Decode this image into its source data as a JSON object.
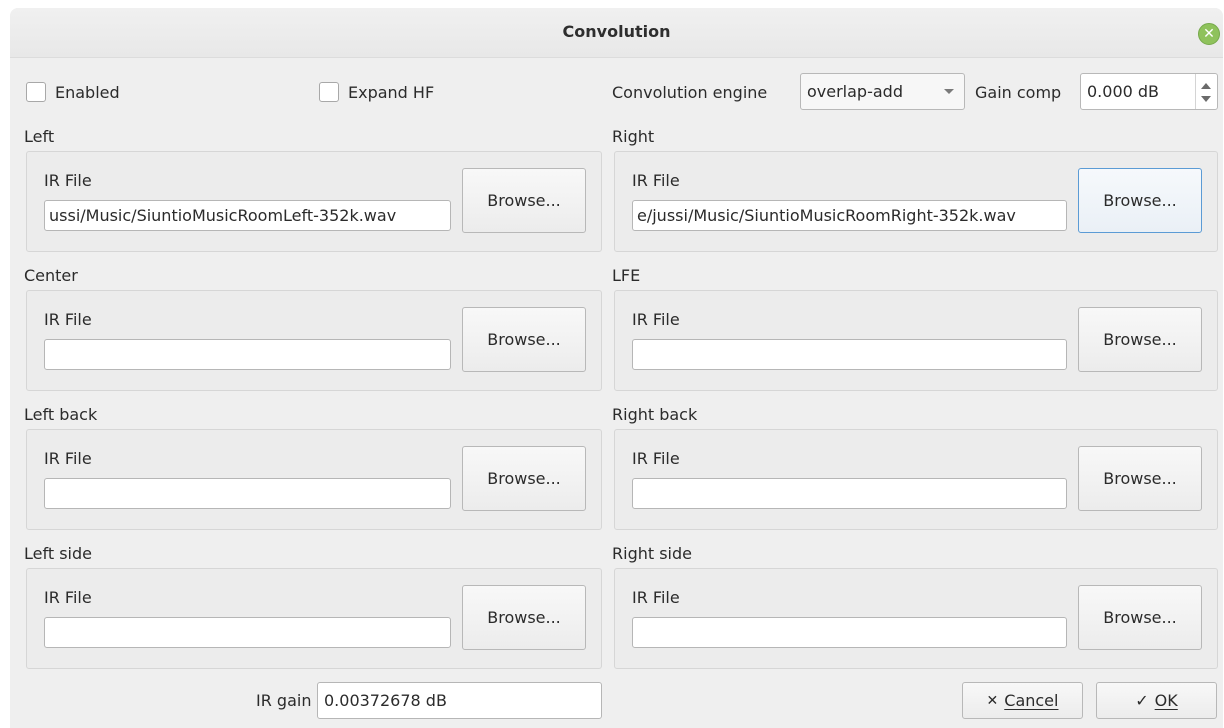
{
  "window": {
    "title": "Convolution"
  },
  "top": {
    "enabled_label": "Enabled",
    "expand_hf_label": "Expand HF",
    "engine_label": "Convolution engine",
    "engine_value": "overlap-add",
    "gain_comp_label": "Gain comp",
    "gain_comp_value": "0.000 dB"
  },
  "channels": [
    {
      "name": "Left",
      "ir_label": "IR File",
      "path": "ussi/Music/SiuntioMusicRoomLeft-352k.wav",
      "browse_label": "Browse..."
    },
    {
      "name": "Right",
      "ir_label": "IR File",
      "path": "e/jussi/Music/SiuntioMusicRoomRight-352k.wav",
      "browse_label": "Browse..."
    },
    {
      "name": "Center",
      "ir_label": "IR File",
      "path": "",
      "browse_label": "Browse..."
    },
    {
      "name": "LFE",
      "ir_label": "IR File",
      "path": "",
      "browse_label": "Browse..."
    },
    {
      "name": "Left back",
      "ir_label": "IR File",
      "path": "",
      "browse_label": "Browse..."
    },
    {
      "name": "Right back",
      "ir_label": "IR File",
      "path": "",
      "browse_label": "Browse..."
    },
    {
      "name": "Left side",
      "ir_label": "IR File",
      "path": "",
      "browse_label": "Browse..."
    },
    {
      "name": "Right side",
      "ir_label": "IR File",
      "path": "",
      "browse_label": "Browse..."
    }
  ],
  "footer": {
    "ir_gain_label": "IR gain",
    "ir_gain_value": "0.00372678 dB",
    "cancel_label": "Cancel",
    "ok_label": "OK"
  },
  "colors": {
    "window_bg": "#efefef",
    "close_button": "#8fc25c",
    "focus_border": "#5b9bd5"
  },
  "icons": {
    "close": "close-icon",
    "cancel": "cross-icon",
    "ok": "checkmark-icon"
  }
}
